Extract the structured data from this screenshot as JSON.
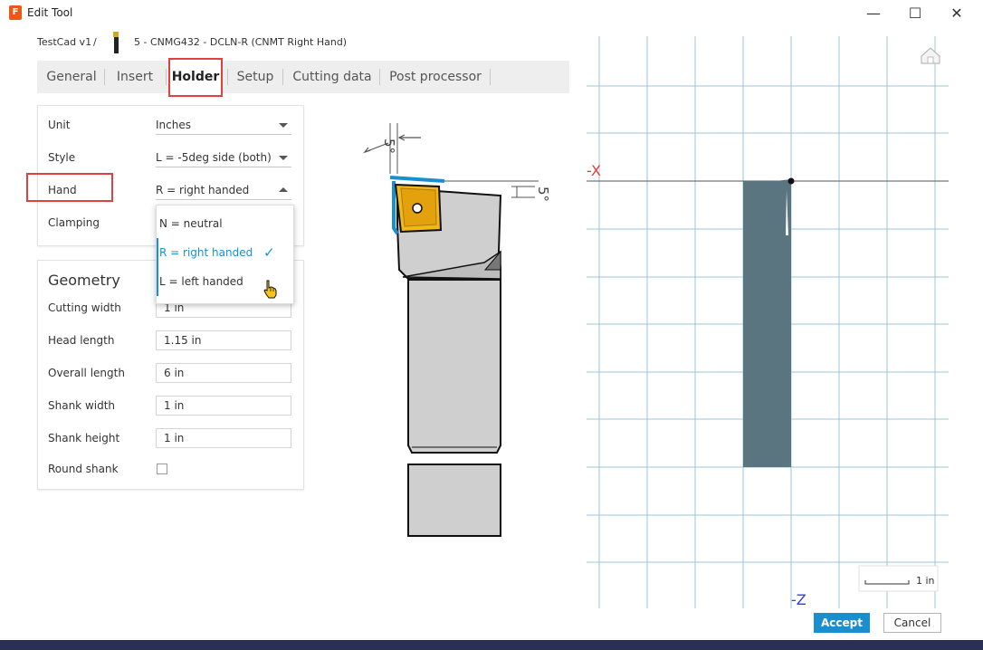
{
  "window": {
    "title": "Edit Tool",
    "app_icon_letter": "F",
    "minimize_glyph": "—",
    "maximize_glyph": "☐",
    "close_glyph": "✕"
  },
  "breadcrumb": {
    "root": "TestCad v1",
    "separator": "/",
    "tool": "5 - CNMG432 - DCLN-R (CNMT Right Hand)"
  },
  "tabs": [
    {
      "label": "General"
    },
    {
      "label": "Insert"
    },
    {
      "label": "Holder",
      "active": true
    },
    {
      "label": "Setup"
    },
    {
      "label": "Cutting data"
    },
    {
      "label": "Post processor"
    }
  ],
  "settings": {
    "unit": {
      "label": "Unit",
      "value": "Inches"
    },
    "style": {
      "label": "Style",
      "value": "L = -5deg side (both)"
    },
    "hand": {
      "label": "Hand",
      "value": "R = right handed"
    },
    "clamping": {
      "label": "Clamping"
    }
  },
  "hand_dropdown": {
    "options": [
      "N = neutral",
      "R = right handed",
      "L = left handed"
    ],
    "selected": "R = right handed",
    "check_glyph": "✓"
  },
  "geometry": {
    "title": "Geometry",
    "fields": [
      {
        "label": "Cutting width",
        "value": "1 in"
      },
      {
        "label": "Head length",
        "value": "1.15 in"
      },
      {
        "label": "Overall length",
        "value": "6 in"
      },
      {
        "label": "Shank width",
        "value": "1 in"
      },
      {
        "label": "Shank height",
        "value": "1 in"
      }
    ],
    "round_shank": {
      "label": "Round shank",
      "checked": false
    }
  },
  "diagram": {
    "angle_top": "5°",
    "angle_side": "5°"
  },
  "viewport": {
    "axis_x_label": "-X",
    "axis_z_label": "-Z",
    "scale_label": "1 in",
    "home_icon": "home-icon",
    "tool_color": "#5a7580",
    "grid_color": "#9bc4d6",
    "axis_label_colors": {
      "x": "#e83a3a",
      "z": "#3a3ae8"
    }
  },
  "actions": {
    "accept": "Accept",
    "cancel": "Cancel"
  },
  "colors": {
    "accent": "#1a8fd0",
    "highlight_box": "#e04040"
  }
}
